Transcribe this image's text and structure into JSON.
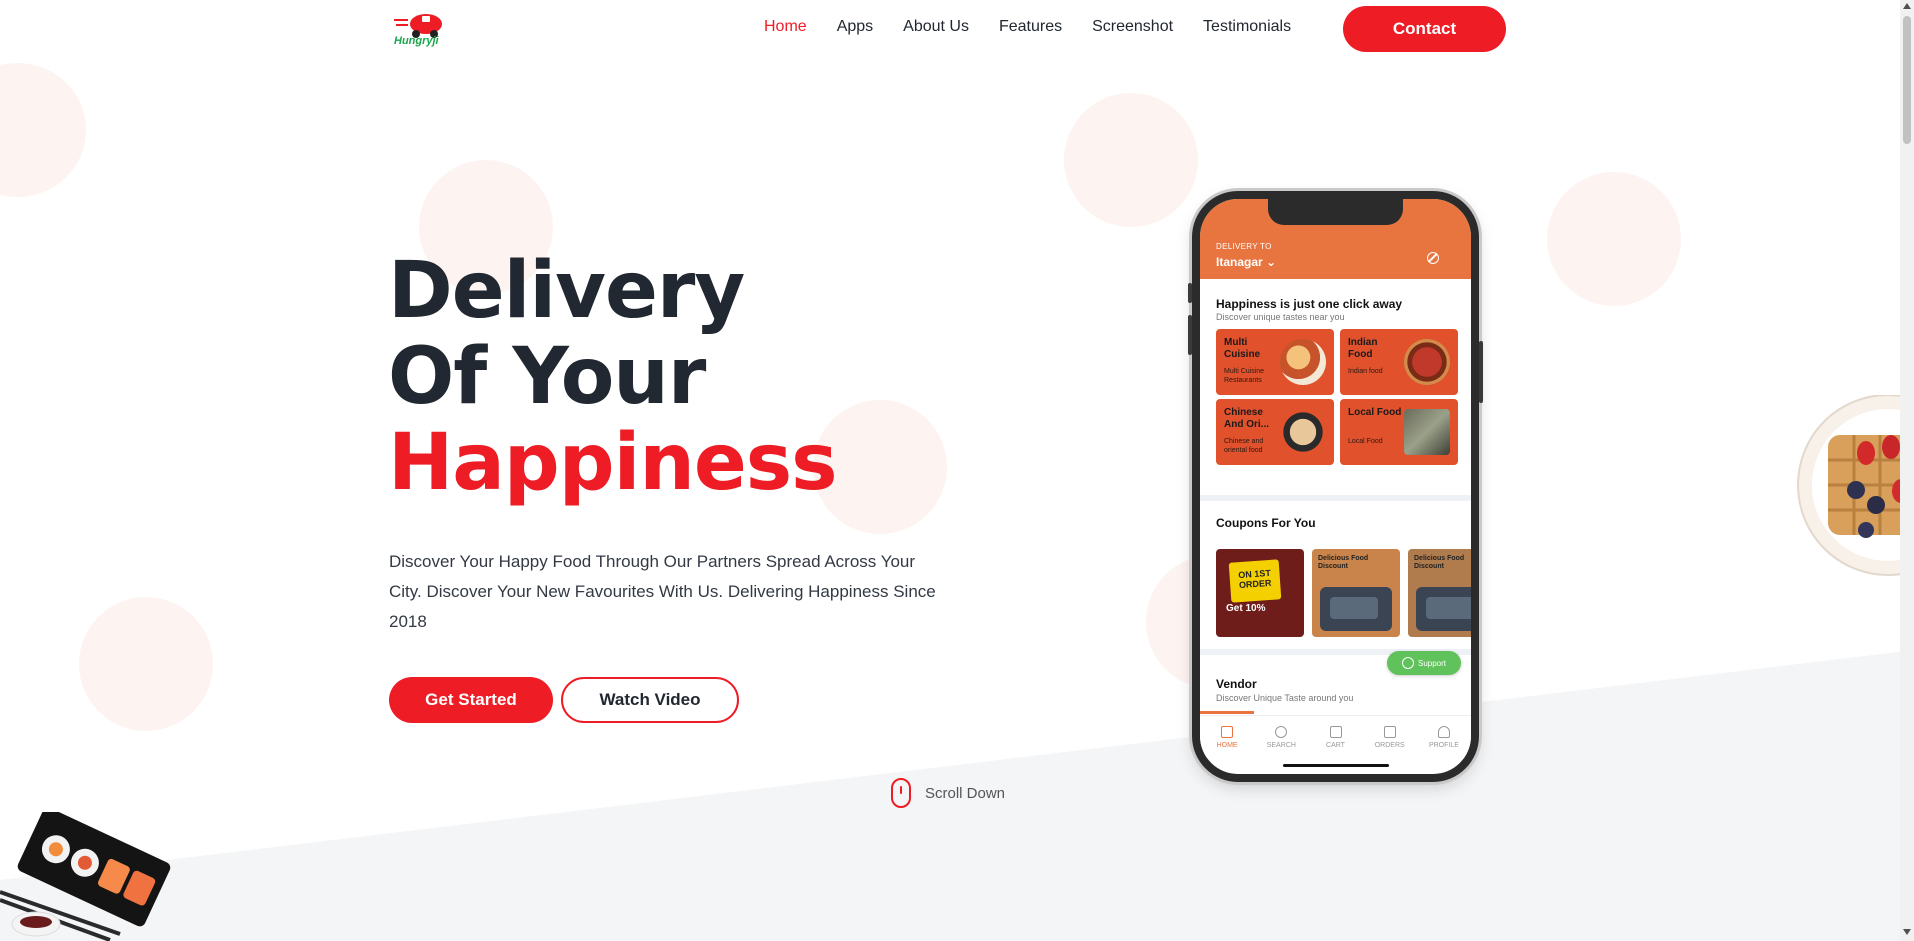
{
  "brand": {
    "name": "Hungryji",
    "color": "#ee1c25",
    "logo_text_color": "#1aa64a"
  },
  "nav": {
    "items": [
      {
        "label": "Home",
        "active": true
      },
      {
        "label": "Apps",
        "active": false
      },
      {
        "label": "About Us",
        "active": false
      },
      {
        "label": "Features",
        "active": false
      },
      {
        "label": "Screenshot",
        "active": false
      },
      {
        "label": "Testimonials",
        "active": false
      }
    ],
    "contact_label": "Contact"
  },
  "hero": {
    "title_line1": "Delivery",
    "title_line2": "Of Your",
    "title_line3": "Happiness",
    "description": "Discover Your Happy Food Through Our Partners Spread Across Your City. Discover Your New Favourites With Us. Delivering Happiness Since 2018",
    "primary_button": "Get Started",
    "secondary_button": "Watch Video",
    "scroll_label": "Scroll Down"
  },
  "phone": {
    "deliver_label": "DELIVERY TO",
    "city": "Itanagar",
    "section1_title": "Happiness is just one click away",
    "section1_sub": "Discover unique tastes near you",
    "categories": [
      {
        "name": "Multi Cuisine",
        "desc": "Multi Cuisine Restaurants"
      },
      {
        "name": "Indian Food",
        "desc": "Indian food"
      },
      {
        "name": "Chinese And Ori...",
        "desc": "Chinese and oriental food"
      },
      {
        "name": "Local Food",
        "desc": "Local Food"
      }
    ],
    "coupons_title": "Coupons For You",
    "coupon1_tag": "ON 1ST ORDER",
    "coupon1_get": "Get 10%",
    "coupon2_head": "Delicious Food Discount",
    "coupon3_head": "Delicious Food Discount",
    "vendor_title": "Vendor",
    "vendor_sub": "Discover Unique Taste around you",
    "support_label": "Support",
    "tabs": [
      {
        "label": "HOME",
        "active": true
      },
      {
        "label": "SEARCH",
        "active": false
      },
      {
        "label": "CART",
        "active": false
      },
      {
        "label": "ORDERS",
        "active": false
      },
      {
        "label": "PROFILE",
        "active": false
      }
    ],
    "accent": "#e8743f",
    "card_color": "#e0512c"
  }
}
